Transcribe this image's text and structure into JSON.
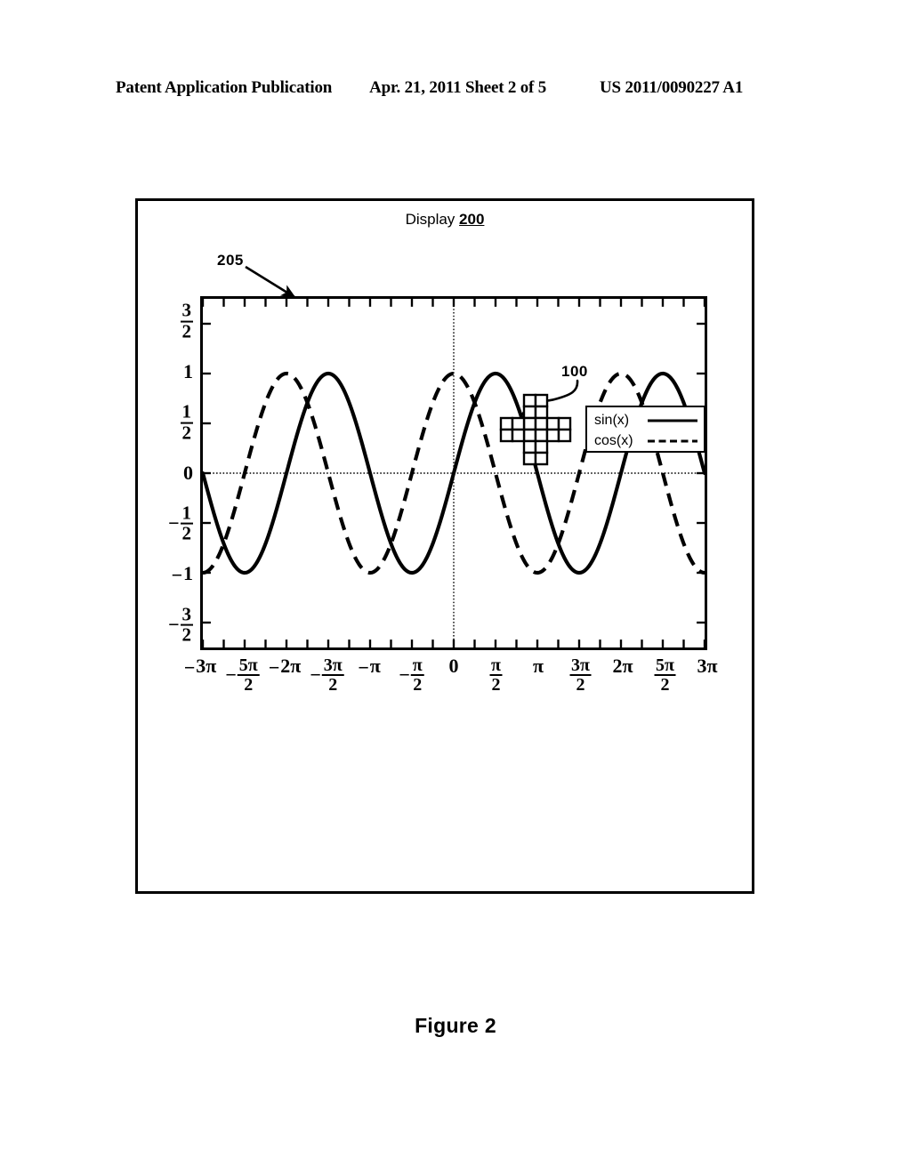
{
  "header": {
    "left": "Patent Application Publication",
    "middle": "Apr. 21, 2011  Sheet 2 of 5",
    "right": "US 2011/0090227 A1"
  },
  "figure": {
    "caption": "Figure 2",
    "title_text": "Display",
    "title_ref": "200",
    "callout_plot_border": "205",
    "callout_cursor": "100"
  },
  "legend": {
    "entries": [
      {
        "label": "sin(x)",
        "style": "solid"
      },
      {
        "label": "cos(x)",
        "style": "dashed"
      }
    ]
  },
  "axes": {
    "y_ticks": [
      {
        "display": "3/2",
        "value": 1.5
      },
      {
        "display": "1",
        "value": 1.0
      },
      {
        "display": "1/2",
        "value": 0.5
      },
      {
        "display": "0",
        "value": 0.0
      },
      {
        "display": "-1/2",
        "value": -0.5
      },
      {
        "display": "-1",
        "value": -1.0
      },
      {
        "display": "-3/2",
        "value": -1.5
      }
    ],
    "x_ticks": [
      {
        "display": "-3π",
        "value": -3.0
      },
      {
        "display": "-5π/2",
        "value": -2.5
      },
      {
        "display": "-2π",
        "value": -2.0
      },
      {
        "display": "-3π/2",
        "value": -1.5
      },
      {
        "display": "-π",
        "value": -1.0
      },
      {
        "display": "-π/2",
        "value": -0.5
      },
      {
        "display": "0",
        "value": 0.0
      },
      {
        "display": "π/2",
        "value": 0.5
      },
      {
        "display": "π",
        "value": 1.0
      },
      {
        "display": "3π/2",
        "value": 1.5
      },
      {
        "display": "2π",
        "value": 2.0
      },
      {
        "display": "5π/2",
        "value": 2.5
      },
      {
        "display": "3π",
        "value": 3.0
      }
    ]
  },
  "chart_data": {
    "type": "line",
    "title": "Display 200",
    "xlabel": "",
    "ylabel": "",
    "xlim": [
      -3.141592653589793,
      3.141592653589793
    ],
    "ylim": [
      -1.75,
      1.75
    ],
    "x_unit": "pi",
    "grid": false,
    "legend_position": "top-right",
    "x_tick_labels": [
      "-3π",
      "-5π/2",
      "-2π",
      "-3π/2",
      "-π",
      "-π/2",
      "0",
      "π/2",
      "π",
      "3π/2",
      "2π",
      "5π/2",
      "3π"
    ],
    "x_tick_values": [
      -3,
      -2.5,
      -2,
      -1.5,
      -1,
      -0.5,
      0,
      0.5,
      1,
      1.5,
      2,
      2.5,
      3
    ],
    "y_tick_labels": [
      "3/2",
      "1",
      "1/2",
      "0",
      "-1/2",
      "-1",
      "-3/2"
    ],
    "y_tick_values": [
      1.5,
      1,
      0.5,
      0,
      -0.5,
      -1,
      -1.5
    ],
    "series": [
      {
        "name": "sin(x)",
        "style": "solid",
        "formula": "sin(x)",
        "x": [
          -3,
          -2.75,
          -2.5,
          -2.25,
          -2,
          -1.75,
          -1.5,
          -1.25,
          -1,
          -0.75,
          -0.5,
          -0.25,
          0,
          0.25,
          0.5,
          0.75,
          1,
          1.25,
          1.5,
          1.75,
          2,
          2.25,
          2.5,
          2.75,
          3
        ],
        "values": [
          0,
          -0.707,
          -1,
          -0.707,
          0,
          0.707,
          1,
          0.707,
          0,
          -0.707,
          -1,
          -0.707,
          0,
          0.707,
          1,
          0.707,
          0,
          -0.707,
          -1,
          -0.707,
          0,
          0.707,
          1,
          0.707,
          0
        ]
      },
      {
        "name": "cos(x)",
        "style": "dashed",
        "formula": "cos(x)",
        "x": [
          -3,
          -2.75,
          -2.5,
          -2.25,
          -2,
          -1.75,
          -1.5,
          -1.25,
          -1,
          -0.75,
          -0.5,
          -0.25,
          0,
          0.25,
          0.5,
          0.75,
          1,
          1.25,
          1.5,
          1.75,
          2,
          2.25,
          2.5,
          2.75,
          3
        ],
        "values": [
          -1,
          -0.707,
          0,
          0.707,
          1,
          0.707,
          0,
          -0.707,
          -1,
          -0.707,
          0,
          0.707,
          1,
          0.707,
          0,
          -0.707,
          -1,
          -0.707,
          0,
          0.707,
          1,
          0.707,
          0,
          -0.707,
          -1
        ]
      }
    ],
    "annotations": [
      {
        "label": "205",
        "target": "plot-border"
      },
      {
        "label": "100",
        "target": "cursor"
      },
      {
        "label": "200",
        "target": "display"
      }
    ],
    "cursor": {
      "shape": "plus-grid",
      "x_value": 0.95,
      "y_value": 0.45
    }
  },
  "colors": {
    "ink": "#000000",
    "paper": "#ffffff"
  }
}
